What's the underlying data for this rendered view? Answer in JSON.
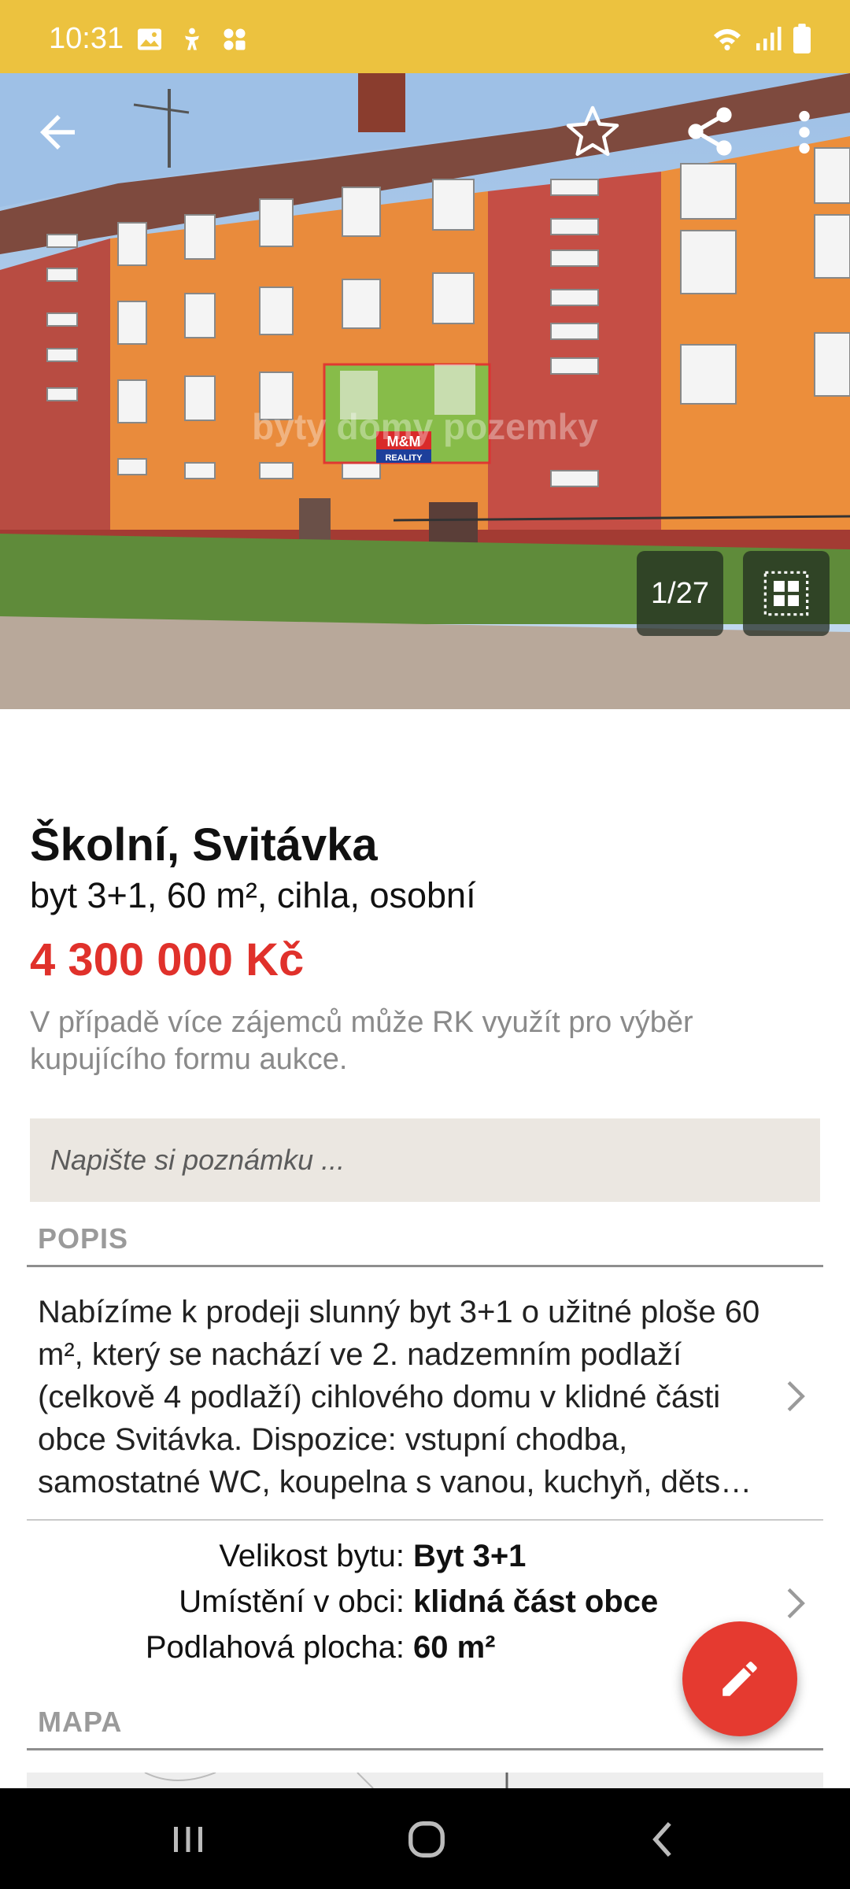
{
  "status_bar": {
    "time": "10:31",
    "left_icons": [
      "image-icon",
      "accessibility-icon",
      "apps-icon"
    ],
    "right_icons": [
      "wifi-icon",
      "signal-icon",
      "battery-icon"
    ],
    "color": "#ecc23f"
  },
  "gallery": {
    "counter": "1/27",
    "watermark": "byty domy pozemky",
    "sign_text": "M&M",
    "sign_sub": "REALITY"
  },
  "listing": {
    "title": "Školní, Svitávka",
    "subtitle": "byt 3+1, 60 m², cihla, osobní",
    "price": "4 300 000 Kč",
    "price_color": "#e0312b",
    "auction_note": "V případě více zájemců může RK využít pro výběr kupujícího formu aukce."
  },
  "note_field": {
    "placeholder": "Napište si poznámku ..."
  },
  "sections": {
    "description_label": "POPIS",
    "map_label": "MAPA"
  },
  "description": {
    "text": "Nabízíme k prodeji slunný byt 3+1 o užitné ploše 60 m², který se nachází ve 2. nadzemním podlaží (celkově 4 podlaží) cihlového domu v klidné části obce Svitávka. Dispozice: vstupní chodba, samostatné WC, koupelna s vanou, kuchyň, děts…"
  },
  "parameters": [
    {
      "key": "Velikost bytu:",
      "value": "Byt 3+1"
    },
    {
      "key": "Umístění v obci:",
      "value": "klidná část obce"
    },
    {
      "key": "Podlahová plocha:",
      "value": "60 m²"
    }
  ],
  "fab": {
    "icon": "edit-icon",
    "color": "#e53a30"
  }
}
